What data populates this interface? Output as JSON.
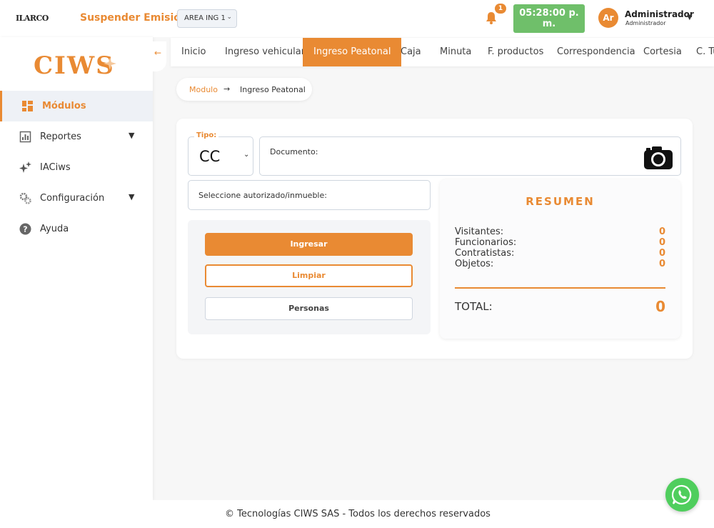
{
  "header": {
    "logo_text": "ILARCO",
    "suspend_label": "Suspender Emisión",
    "area_select_value": "AREA ING 1",
    "notification_count": "1",
    "clock_time_line1": "05:28:00 p.",
    "clock_time_line2": "m.",
    "avatar_initials": "Ar",
    "user_name": "Administrador",
    "user_role": "Administrador"
  },
  "sidebar": {
    "brand": "CIWS",
    "items": [
      {
        "label": "Módulos",
        "icon": "grid-icon",
        "active": true
      },
      {
        "label": "Reportes",
        "icon": "report-icon",
        "has_caret": true
      },
      {
        "label": "IACiws",
        "icon": "sparkle-icon"
      },
      {
        "label": "Configuración",
        "icon": "gears-icon",
        "has_caret": true
      },
      {
        "label": "Ayuda",
        "icon": "help-icon"
      }
    ]
  },
  "tabs": [
    {
      "label": "Inicio"
    },
    {
      "label": "Ingreso vehicular"
    },
    {
      "label": "Ingreso Peatonal",
      "active": true
    },
    {
      "label": "Caja"
    },
    {
      "label": "Minuta"
    },
    {
      "label": "F. productos"
    },
    {
      "label": "Correspondencia"
    },
    {
      "label": "Cortesia"
    },
    {
      "label": "C. Tu"
    }
  ],
  "breadcrumb": {
    "root": "Modulo",
    "separator": "→",
    "current": "Ingreso Peatonal"
  },
  "form": {
    "tipo_label": "Tipo:",
    "tipo_value": "CC",
    "documento_label": "Documento:",
    "seleccione_label": "Seleccione autorizado/inmueble:",
    "btn_ingresar": "Ingresar",
    "btn_limpiar": "Limpiar",
    "btn_personas": "Personas"
  },
  "resumen": {
    "title": "RESUMEN",
    "rows": [
      {
        "label": "Visitantes:",
        "value": "0"
      },
      {
        "label": "Funcionarios:",
        "value": "0"
      },
      {
        "label": "Contratistas:",
        "value": "0"
      },
      {
        "label": "Objetos:",
        "value": "0"
      }
    ],
    "total_label": "TOTAL:",
    "total_value": "0"
  },
  "footer": {
    "text": "© Tecnologías CIWS SAS - Todos los derechos reservados"
  },
  "colors": {
    "accent": "#e98a33",
    "clock_bg": "#6fbf6a",
    "whatsapp": "#4fce5d"
  }
}
